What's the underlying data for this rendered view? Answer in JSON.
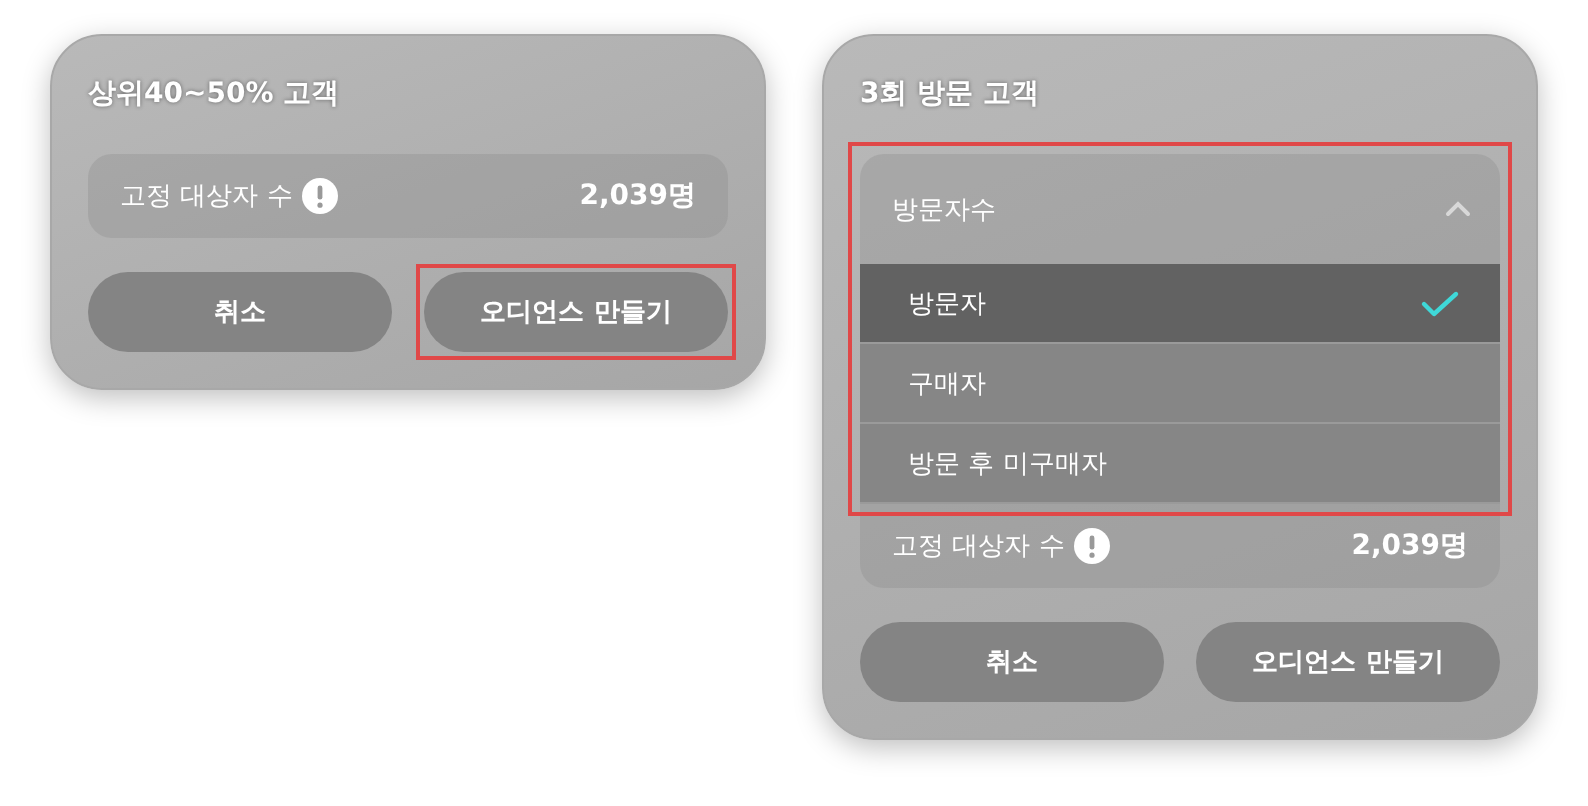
{
  "cards": [
    {
      "title": "상위40~50% 고객",
      "info": {
        "label": "고정 대상자 수",
        "value": "2,039명"
      },
      "buttons": [
        {
          "label": "취소",
          "highlighted": false
        },
        {
          "label": "오디언스 만들기",
          "highlighted": true
        }
      ]
    },
    {
      "title": "3회 방문 고객",
      "dropdown": {
        "label": "방문자수",
        "expanded": true,
        "highlighted": true,
        "options": [
          {
            "label": "방문자",
            "selected": true
          },
          {
            "label": "구매자",
            "selected": false
          },
          {
            "label": "방문 후 미구매자",
            "selected": false
          }
        ]
      },
      "info": {
        "label": "고정 대상자 수",
        "value": "2,039명"
      },
      "buttons": [
        {
          "label": "취소",
          "highlighted": false
        },
        {
          "label": "오디언스 만들기",
          "highlighted": false
        }
      ]
    }
  ]
}
